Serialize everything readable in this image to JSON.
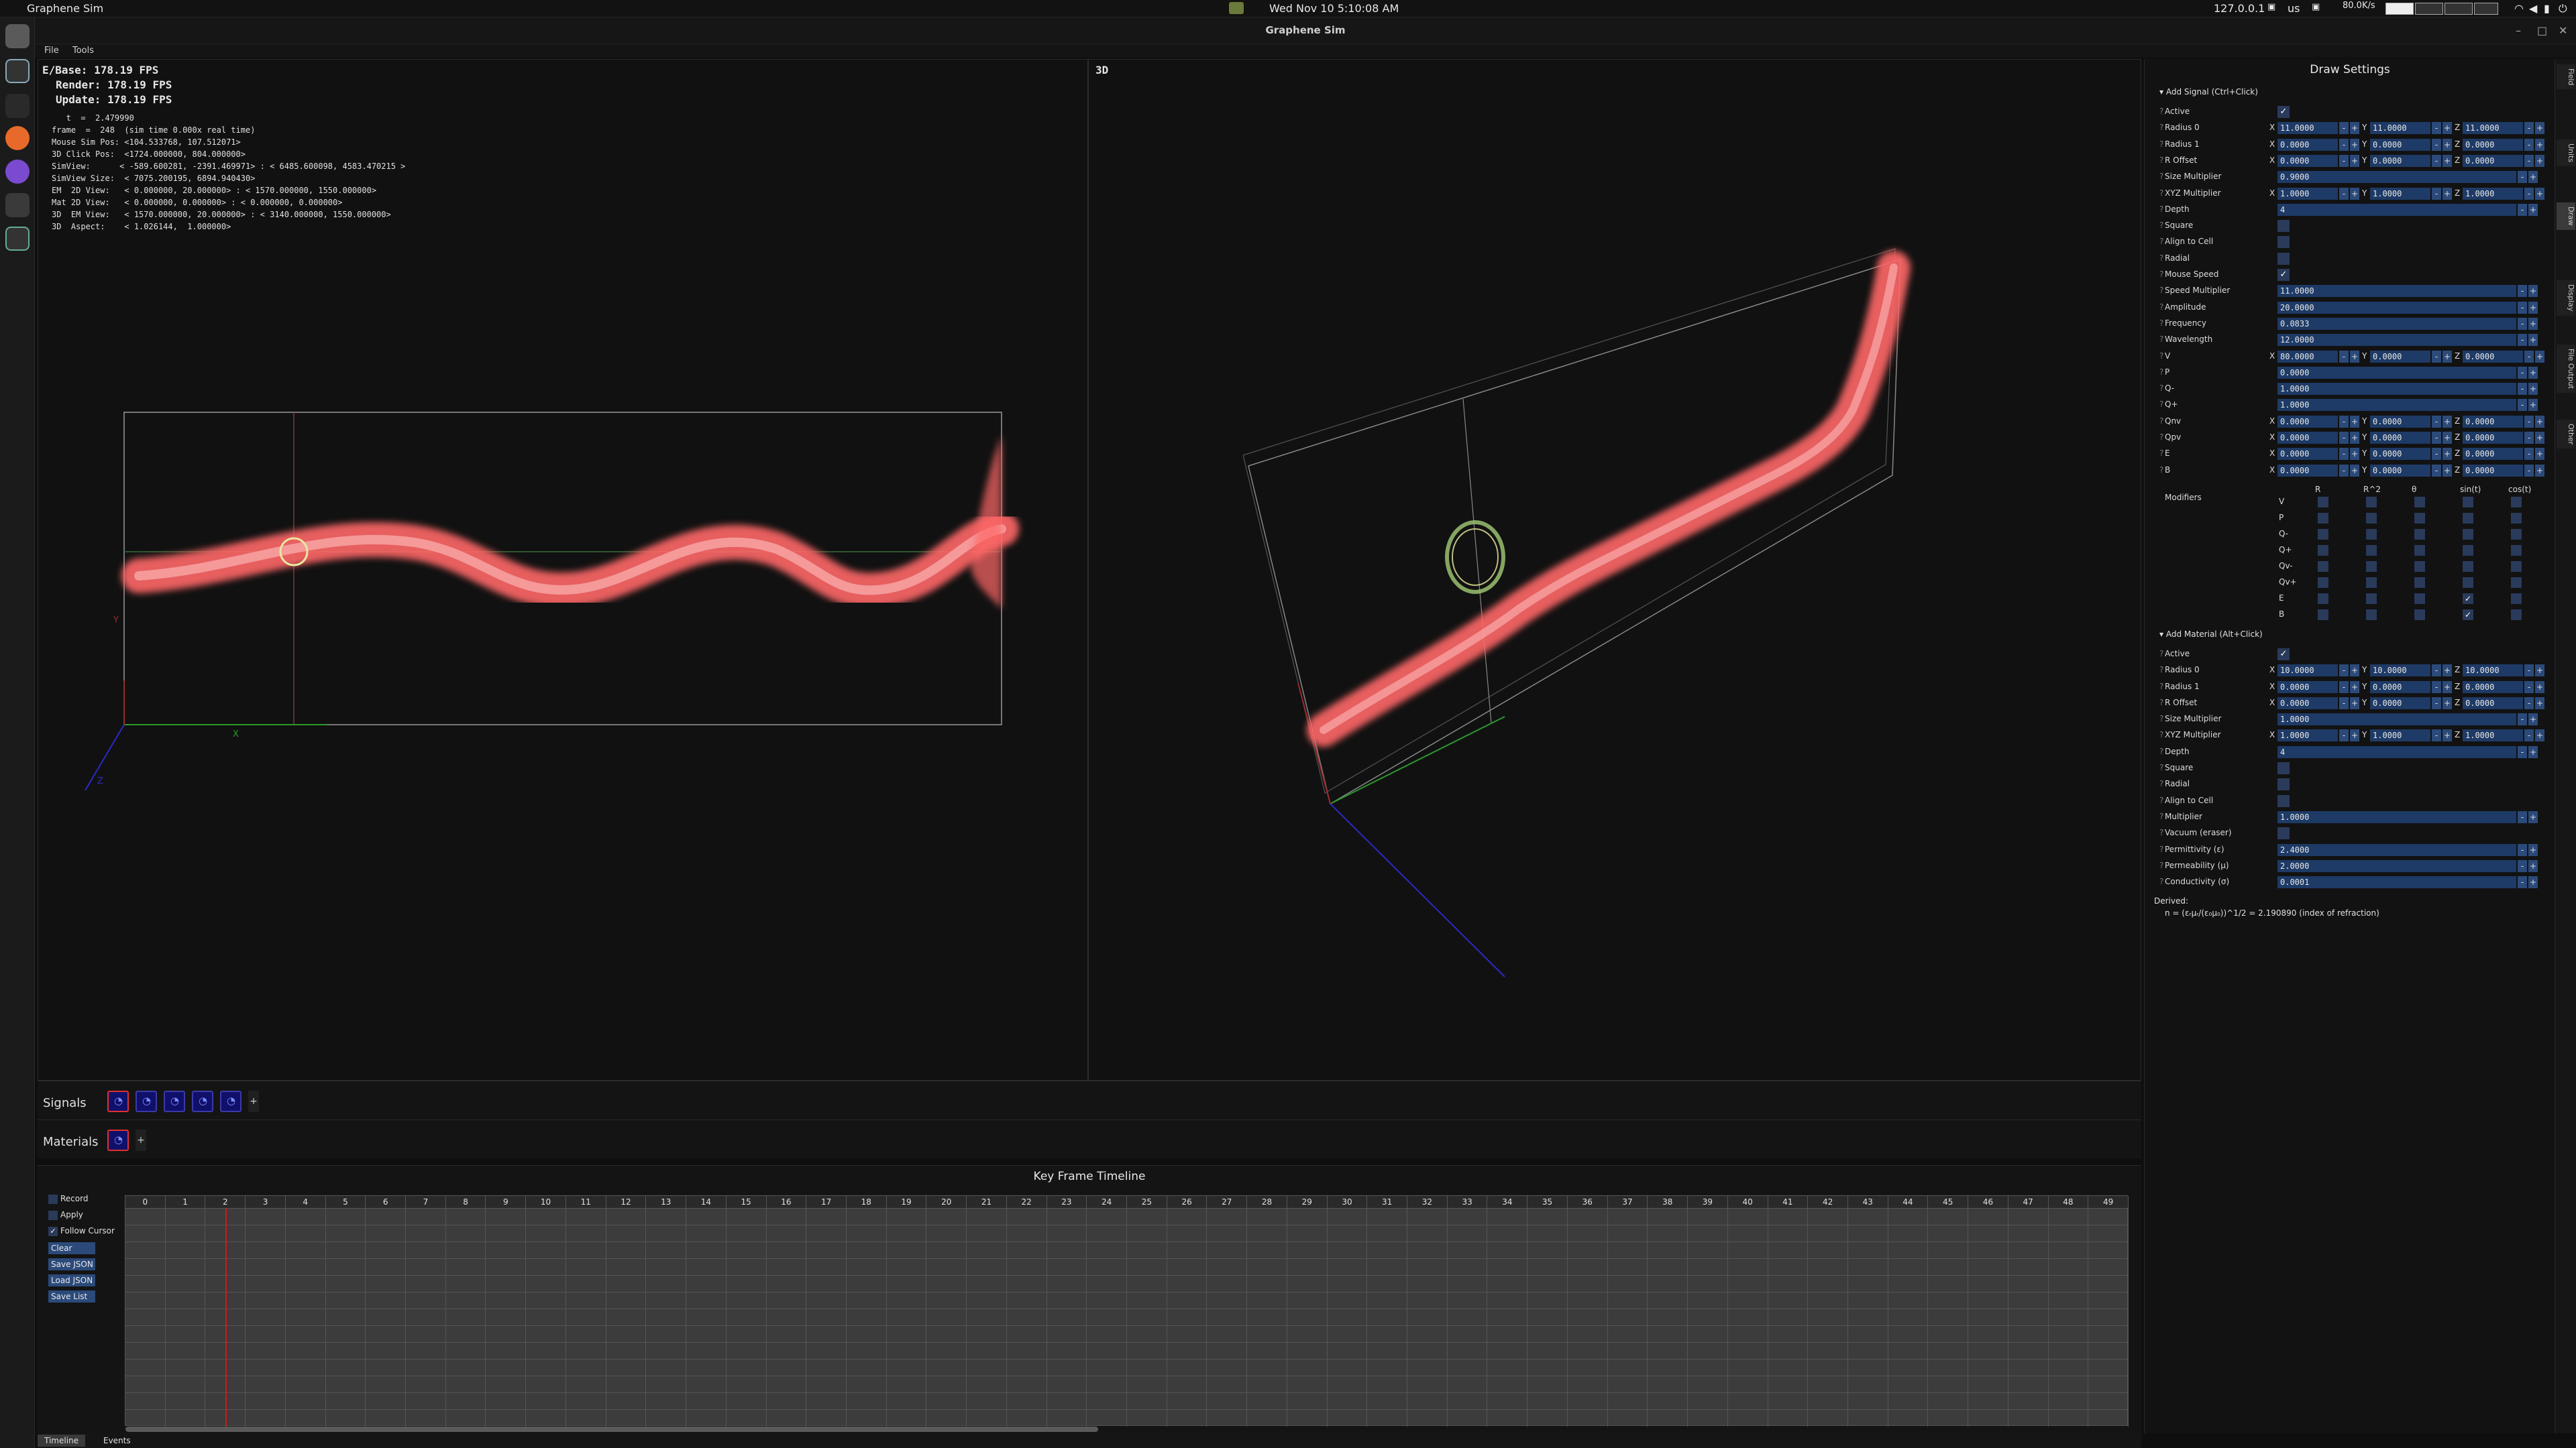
{
  "system": {
    "app_name": "Graphene Sim",
    "datetime": "Wed Nov 10   5:10:08 AM",
    "ip": "127.0.0.1",
    "keyboard": "us",
    "netspeed": "80.0K/s"
  },
  "window": {
    "title": "Graphene Sim",
    "menu": [
      "File",
      "Tools"
    ]
  },
  "view2d": {
    "stats": [
      "E/Base:   178.19 FPS",
      "Render: 178.19 FPS",
      "Update: 178.19 FPS"
    ],
    "debug": [
      "   t  =  2.479990",
      "frame  =  248  (sim time 0.000x real time)",
      "Mouse Sim Pos: <104.533768, 107.512071>",
      "3D Click Pos:  <1724.000000, 804.000000>",
      "SimView:      < -589.600281, -2391.469971> : < 6485.600098, 4583.470215 >",
      "SimView Size:  < 7075.200195, 6894.940430>",
      "EM  2D View:   < 0.000000, 20.000000> : < 1570.000000, 1550.000000>",
      "Mat 2D View:   < 0.000000, 0.000000> : < 0.000000, 0.000000>",
      "3D  EM View:   < 1570.000000, 20.000000> : < 3140.000000, 1550.000000>",
      "3D  Aspect:    < 1.026144,  1.000000>"
    ],
    "axis_x": "X",
    "axis_y": "Y",
    "axis_z": "Z"
  },
  "view3d": {
    "label": "3D"
  },
  "signals": {
    "label": "Signals",
    "count": 5
  },
  "materials": {
    "label": "Materials",
    "count": 1
  },
  "timeline": {
    "title": "Key Frame Timeline",
    "record": "Record",
    "apply": "Apply",
    "follow": "Follow Cursor",
    "clear": "Clear",
    "save_json": "Save JSON",
    "load_json": "Load JSON",
    "save_list": "Save List",
    "frames": [
      "0",
      "1",
      "2",
      "3",
      "4",
      "5",
      "6",
      "7",
      "8",
      "9",
      "10",
      "11",
      "12",
      "13",
      "14",
      "15",
      "16",
      "17",
      "18",
      "19",
      "20",
      "21",
      "22",
      "23",
      "24",
      "25",
      "26",
      "27",
      "28",
      "29",
      "30",
      "31",
      "32",
      "33",
      "34",
      "35",
      "36",
      "37",
      "38",
      "39",
      "40",
      "41",
      "42",
      "43",
      "44",
      "45",
      "46",
      "47",
      "48",
      "49"
    ],
    "current_frame": 2,
    "tabs": [
      "Timeline",
      "Events"
    ]
  },
  "settings": {
    "title": "Draw Settings",
    "signal_header": "Add Signal (Ctrl+Click)",
    "material_header": "Add Material (Alt+Click)",
    "signal_rows": [
      {
        "label": "Active",
        "type": "check",
        "checked": true
      },
      {
        "label": "Radius 0",
        "type": "xyz",
        "x": "11.0000",
        "y": "11.0000",
        "z": "11.0000"
      },
      {
        "label": "Radius 1",
        "type": "xyz",
        "x": "0.0000",
        "y": "0.0000",
        "z": "0.0000"
      },
      {
        "label": "R Offset",
        "type": "xyz",
        "x": "0.0000",
        "y": "0.0000",
        "z": "0.0000"
      },
      {
        "label": "Size Multiplier",
        "type": "value",
        "value": "0.9000"
      },
      {
        "label": "XYZ Multiplier",
        "type": "xyz",
        "x": "1.0000",
        "y": "1.0000",
        "z": "1.0000"
      },
      {
        "label": "Depth",
        "type": "value",
        "value": "4"
      },
      {
        "label": "Square",
        "type": "check",
        "checked": false
      },
      {
        "label": "Align to Cell",
        "type": "check",
        "checked": false
      },
      {
        "label": "Radial",
        "type": "check",
        "checked": false
      },
      {
        "label": "Mouse Speed",
        "type": "check",
        "checked": true
      },
      {
        "label": "Speed Multiplier",
        "type": "value",
        "value": "11.0000"
      },
      {
        "label": "Amplitude",
        "type": "value",
        "value": "20.0000"
      },
      {
        "label": "Frequency",
        "type": "value",
        "value": "0.0833"
      },
      {
        "label": "Wavelength",
        "type": "value",
        "value": "12.0000"
      },
      {
        "label": "V",
        "type": "xyz",
        "x": "80.0000",
        "y": "0.0000",
        "z": "0.0000"
      },
      {
        "label": "P",
        "type": "value",
        "value": "0.0000"
      },
      {
        "label": "Q-",
        "type": "value",
        "value": "1.0000"
      },
      {
        "label": "Q+",
        "type": "value",
        "value": "1.0000"
      },
      {
        "label": "Qnv",
        "type": "xyz",
        "x": "0.0000",
        "y": "0.0000",
        "z": "0.0000"
      },
      {
        "label": "Qpv",
        "type": "xyz",
        "x": "0.0000",
        "y": "0.0000",
        "z": "0.0000"
      },
      {
        "label": "E",
        "type": "xyz",
        "x": "0.0000",
        "y": "0.0000",
        "z": "0.0000"
      },
      {
        "label": "B",
        "type": "xyz",
        "x": "0.0000",
        "y": "0.0000",
        "z": "0.0000"
      }
    ],
    "modifiers": {
      "label": "Modifiers",
      "columns": [
        "R",
        "R^2",
        "θ",
        "sin(t)",
        "cos(t)"
      ],
      "rows": [
        "V",
        "P",
        "Q-",
        "Q+",
        "Qv-",
        "Qv+",
        "E",
        "B"
      ],
      "checked": [
        [
          6,
          3
        ],
        [
          7,
          3
        ]
      ]
    },
    "material_rows": [
      {
        "label": "Active",
        "type": "check",
        "checked": true
      },
      {
        "label": "Radius 0",
        "type": "xyz",
        "x": "10.0000",
        "y": "10.0000",
        "z": "10.0000"
      },
      {
        "label": "Radius 1",
        "type": "xyz",
        "x": "0.0000",
        "y": "0.0000",
        "z": "0.0000"
      },
      {
        "label": "R Offset",
        "type": "xyz",
        "x": "0.0000",
        "y": "0.0000",
        "z": "0.0000"
      },
      {
        "label": "Size Multiplier",
        "type": "value",
        "value": "1.0000"
      },
      {
        "label": "XYZ Multiplier",
        "type": "xyz",
        "x": "1.0000",
        "y": "1.0000",
        "z": "1.0000"
      },
      {
        "label": "Depth",
        "type": "value",
        "value": "4"
      },
      {
        "label": "Square",
        "type": "check",
        "checked": false
      },
      {
        "label": "Radial",
        "type": "check",
        "checked": false
      },
      {
        "label": "Align to Cell",
        "type": "check",
        "checked": false
      },
      {
        "label": "Multiplier",
        "type": "value",
        "value": "1.0000"
      },
      {
        "label": "Vacuum (eraser)",
        "type": "check",
        "checked": false
      },
      {
        "label": "Permittivity (ε)",
        "type": "value",
        "value": "2.4000"
      },
      {
        "label": "Permeability (μ)",
        "type": "value",
        "value": "2.0000"
      },
      {
        "label": "Conductivity (σ)",
        "type": "value",
        "value": "0.0001"
      }
    ],
    "derived_label": "Derived:",
    "derived_text": "n = (εᵣμᵣ/(ε₀μ₀))^1/2  = 2.190890  (index of refraction)"
  },
  "side_tabs": [
    "Field",
    "Units",
    "Draw",
    "Display",
    "File Output",
    "Other"
  ],
  "colors": {
    "accent": "#1e3a66",
    "plasma": "#ff7070",
    "background": "#111111"
  }
}
